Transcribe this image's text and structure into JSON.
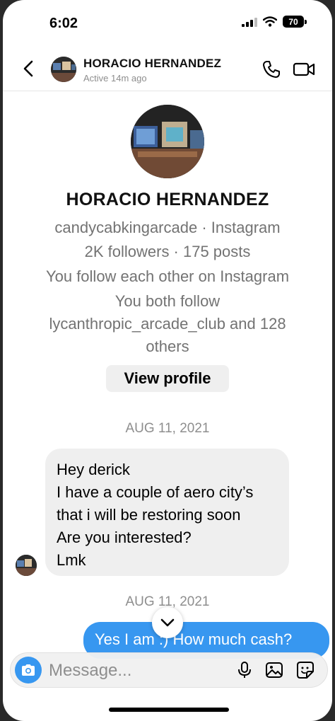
{
  "status_bar": {
    "time": "6:02",
    "battery": "70"
  },
  "header": {
    "name": "HORACIO HERNANDEZ",
    "status": "Active 14m ago"
  },
  "profile": {
    "name": "HORACIO HERNANDEZ",
    "handle_line": "candycabkingarcade · Instagram",
    "stats_line": "2K followers · 175 posts",
    "follow_line": "You follow each other on Instagram",
    "mutual_line1": "You both follow",
    "mutual_line2": "lycanthropic_arcade_club and 128",
    "mutual_line3": "others",
    "view_profile_label": "View profile"
  },
  "thread": {
    "date1": "AUG 11, 2021",
    "received_message": {
      "lines": [
        "Hey derick",
        "I have a couple of aero city’s",
        "that i will be restoring soon",
        "Are you interested?",
        "Lmk"
      ]
    },
    "date2": "AUG 11, 2021",
    "sent_message": "Yes I am :) How much cash?"
  },
  "composer": {
    "placeholder": "Message..."
  },
  "icons": {
    "back": "chevron-left-icon",
    "call": "phone-icon",
    "video": "video-camera-icon",
    "camera": "camera-icon",
    "mic": "microphone-icon",
    "gallery": "image-icon",
    "sticker": "sticker-icon",
    "scroll": "chevron-down-icon"
  },
  "colors": {
    "accent": "#3797f0",
    "received_bubble": "#efefef",
    "muted_text": "#737373"
  }
}
